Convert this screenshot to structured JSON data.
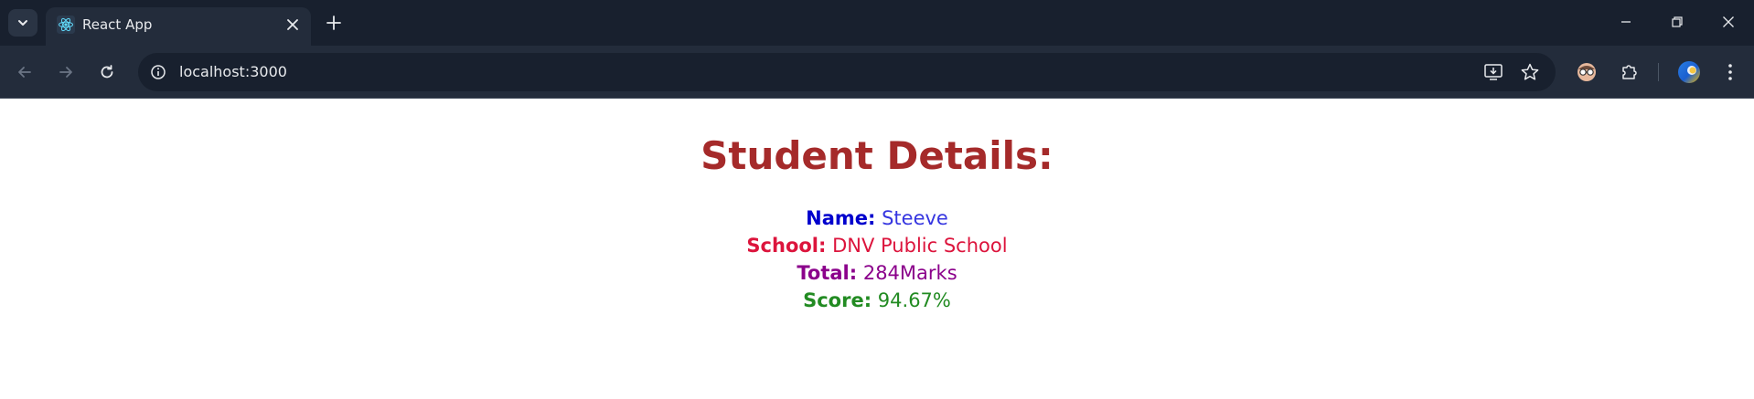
{
  "browser": {
    "tab_title": "React App",
    "url": "localhost:3000",
    "icons": {
      "tab_search": "chevron-down-icon",
      "favicon": "react-logo-icon",
      "tab_close": "close-icon",
      "new_tab": "plus-icon",
      "back": "arrow-left-icon",
      "forward": "arrow-right-icon",
      "reload": "reload-icon",
      "site_info": "info-icon",
      "install": "install-app-icon",
      "bookmark": "star-icon",
      "extension_avatar": "glasses-avatar-icon",
      "extensions": "puzzle-icon",
      "profile": "profile-icon",
      "menu": "kebab-menu-icon",
      "minimize": "minimize-icon",
      "restore": "restore-icon",
      "close_window": "close-icon"
    }
  },
  "page": {
    "heading": "Student Details:",
    "details": {
      "name_label": "Name:",
      "name_value": "Steeve",
      "school_label": "School:",
      "school_value": "DNV Public School",
      "total_label": "Total:",
      "total_value": "284Marks",
      "score_label": "Score:",
      "score_value": "94.67%"
    }
  },
  "colors": {
    "heading": "#a52a2a",
    "name": "#0000cd",
    "school": "#dc143c",
    "total": "#8b008b",
    "score": "#228b22",
    "chrome_dark": "#18202e",
    "chrome_light": "#232c3b"
  }
}
